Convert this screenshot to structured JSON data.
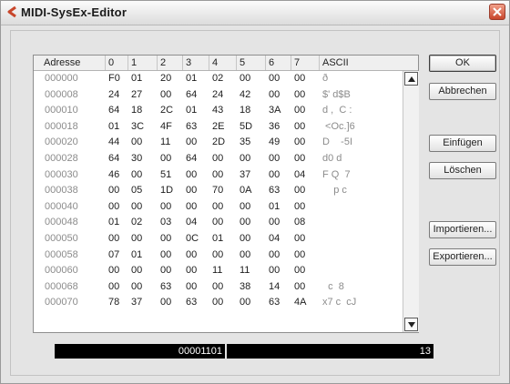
{
  "window": {
    "title": "MIDI-SysEx-Editor"
  },
  "table": {
    "columns": [
      "Adresse",
      "0",
      "1",
      "2",
      "3",
      "4",
      "5",
      "6",
      "7",
      "ASCII"
    ],
    "rows": [
      [
        "000000",
        "F0",
        "01",
        "20",
        "01",
        "02",
        "00",
        "00",
        "00",
        "ð"
      ],
      [
        "000008",
        "24",
        "27",
        "00",
        "64",
        "24",
        "42",
        "00",
        "00",
        "$' d$B"
      ],
      [
        "000010",
        "64",
        "18",
        "2C",
        "01",
        "43",
        "18",
        "3A",
        "00",
        "d ,  C :"
      ],
      [
        "000018",
        "01",
        "3C",
        "4F",
        "63",
        "2E",
        "5D",
        "36",
        "00",
        " <Oc.]6"
      ],
      [
        "000020",
        "44",
        "00",
        "11",
        "00",
        "2D",
        "35",
        "49",
        "00",
        "D    -5I"
      ],
      [
        "000028",
        "64",
        "30",
        "00",
        "64",
        "00",
        "00",
        "00",
        "00",
        "d0 d"
      ],
      [
        "000030",
        "46",
        "00",
        "51",
        "00",
        "00",
        "37",
        "00",
        "04",
        "F Q  7"
      ],
      [
        "000038",
        "00",
        "05",
        "1D",
        "00",
        "70",
        "0A",
        "63",
        "00",
        "    p c"
      ],
      [
        "000040",
        "00",
        "00",
        "00",
        "00",
        "00",
        "00",
        "01",
        "00",
        ""
      ],
      [
        "000048",
        "01",
        "02",
        "03",
        "04",
        "00",
        "00",
        "00",
        "08",
        ""
      ],
      [
        "000050",
        "00",
        "00",
        "00",
        "0C",
        "01",
        "00",
        "04",
        "00",
        ""
      ],
      [
        "000058",
        "07",
        "01",
        "00",
        "00",
        "00",
        "00",
        "00",
        "00",
        ""
      ],
      [
        "000060",
        "00",
        "00",
        "00",
        "00",
        "11",
        "11",
        "00",
        "00",
        ""
      ],
      [
        "000068",
        "00",
        "00",
        "63",
        "00",
        "00",
        "38",
        "14",
        "00",
        "  c  8"
      ],
      [
        "000070",
        "78",
        "37",
        "00",
        "63",
        "00",
        "00",
        "63",
        "4A",
        "x7 c  cJ"
      ]
    ]
  },
  "buttons": {
    "ok": "OK",
    "cancel": "Abbrechen",
    "insert": "Einfügen",
    "delete": "Löschen",
    "import": "Importieren...",
    "export": "Exportieren..."
  },
  "status": {
    "left": "00001101",
    "right": "13"
  },
  "colors": {
    "close": "#c8462b",
    "readout_bg": "#000000",
    "icon": "#c8462b"
  }
}
